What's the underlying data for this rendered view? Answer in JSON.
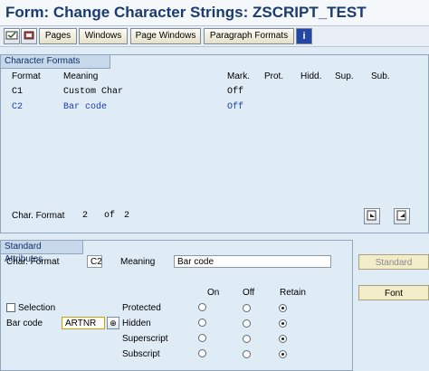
{
  "title": "Form: Change Character Strings: ZSCRIPT_TEST",
  "toolbar": {
    "buttons": [
      "Pages",
      "Windows",
      "Page Windows",
      "Paragraph Formats"
    ],
    "icons": [
      "checkmark-icon",
      "prev-screen-icon",
      "info-icon"
    ]
  },
  "char_formats": {
    "label": "Character Formats",
    "columns": [
      "Format",
      "Meaning",
      "Mark.",
      "Prot.",
      "Hidd.",
      "Sup.",
      "Sub."
    ],
    "rows": [
      {
        "format": "C1",
        "meaning": "Custom Char",
        "mark": "Off"
      },
      {
        "format": "C2",
        "meaning": "Bar code",
        "mark": "Off"
      }
    ],
    "counter_label": "Char. Format",
    "counter_current": "2",
    "counter_of": "of",
    "counter_total": "2"
  },
  "attributes": {
    "label": "Standard Attributes",
    "char_format_label": "Char. Format",
    "char_format_value": "C2",
    "meaning_label": "Meaning",
    "meaning_value": "Bar code",
    "selection_label": "Selection",
    "barcode_label": "Bar code",
    "barcode_value": "ARTNR",
    "col_on": "On",
    "col_off": "Off",
    "col_retain": "Retain",
    "props": [
      "Protected",
      "Hidden",
      "Superscript",
      "Subscript"
    ]
  },
  "side": {
    "standard": "Standard",
    "font": "Font"
  },
  "colors": {
    "title": "#1a3b6e",
    "selected_row": "#1b3fb0",
    "background": "#dfebf5"
  }
}
